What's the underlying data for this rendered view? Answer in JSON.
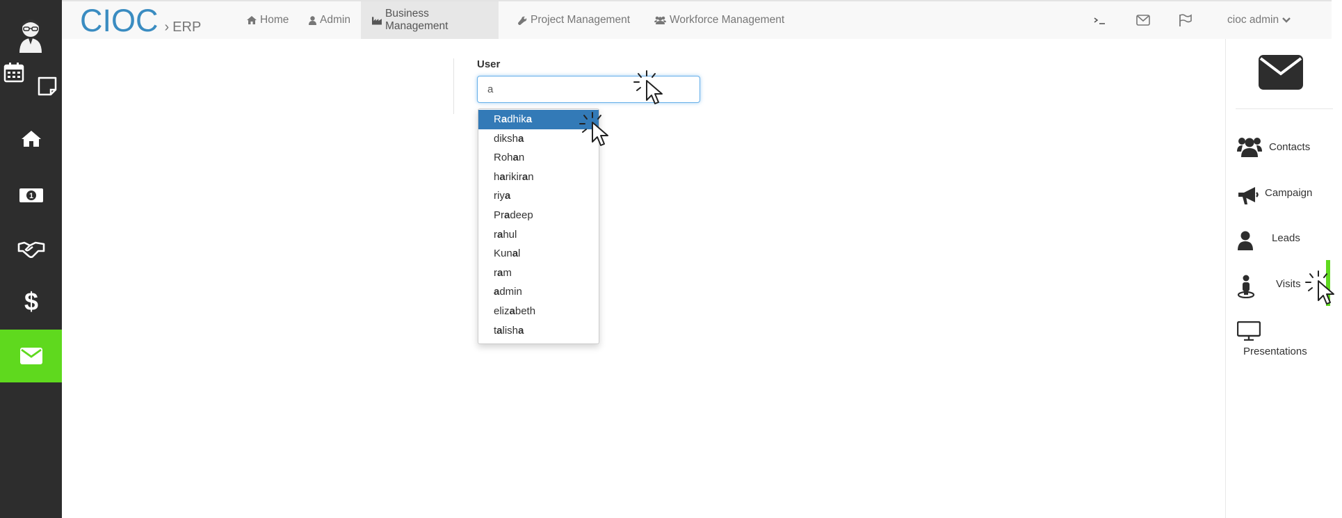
{
  "brand": {
    "name": "CIOC",
    "separator": "›",
    "module": "ERP"
  },
  "topnav": {
    "links": [
      {
        "label": "Home",
        "icon": "home-icon"
      },
      {
        "label": "Admin",
        "icon": "user-icon"
      },
      {
        "label": "Business Management",
        "icon": "industry-icon",
        "active": true
      },
      {
        "label": "Project Management",
        "icon": "wrench-icon"
      },
      {
        "label": "Workforce Management",
        "icon": "users-icon"
      }
    ],
    "right_icons": [
      "terminal-icon",
      "envelope-icon",
      "flag-icon"
    ],
    "user_menu": "cioc admin"
  },
  "left_sidebar": {
    "items": [
      "avatar",
      "calendar-icon",
      "sticky-note-icon",
      "home-icon",
      "money-icon",
      "handshake-icon",
      "dollar-icon",
      "envelope-icon"
    ],
    "active": "envelope-icon"
  },
  "form": {
    "label": "User",
    "input_value": "a",
    "suggestions": [
      {
        "pre": "R",
        "match": "a",
        "post": "dhik",
        "match2": "a",
        "post2": ""
      },
      {
        "pre": "diksh",
        "match": "a",
        "post": "",
        "match2": "",
        "post2": ""
      },
      {
        "pre": "Roh",
        "match": "a",
        "post": "n",
        "match2": "",
        "post2": ""
      },
      {
        "pre": "h",
        "match": "a",
        "post": "rikir",
        "match2": "a",
        "post2": "n"
      },
      {
        "pre": "riy",
        "match": "a",
        "post": "",
        "match2": "",
        "post2": ""
      },
      {
        "pre": "Pr",
        "match": "a",
        "post": "deep",
        "match2": "",
        "post2": ""
      },
      {
        "pre": "r",
        "match": "a",
        "post": "hul",
        "match2": "",
        "post2": ""
      },
      {
        "pre": "Kun",
        "match": "a",
        "post": "l",
        "match2": "",
        "post2": ""
      },
      {
        "pre": "r",
        "match": "a",
        "post": "m",
        "match2": "",
        "post2": ""
      },
      {
        "pre": "",
        "match": "a",
        "post": "dmin",
        "match2": "",
        "post2": ""
      },
      {
        "pre": "eliz",
        "match": "a",
        "post": "beth",
        "match2": "",
        "post2": ""
      },
      {
        "pre": "t",
        "match": "a",
        "post": "lish",
        "match2": "a",
        "post2": ""
      }
    ],
    "active_index": 0
  },
  "right_panel": {
    "items": [
      {
        "label": "Contacts",
        "icon": "users-icon"
      },
      {
        "label": "Campaign",
        "icon": "bullhorn-icon"
      },
      {
        "label": "Leads",
        "icon": "user-icon"
      },
      {
        "label": "Visits",
        "icon": "map-marker-person-icon"
      },
      {
        "label": "Presentations",
        "icon": "desktop-icon"
      }
    ]
  },
  "colors": {
    "sidebar_bg": "#2d2d2d",
    "sidebar_active": "#5fd91e",
    "brand_blue": "#3a8cc1",
    "selection_blue": "#337ab7",
    "focus_border": "#66afe9"
  }
}
